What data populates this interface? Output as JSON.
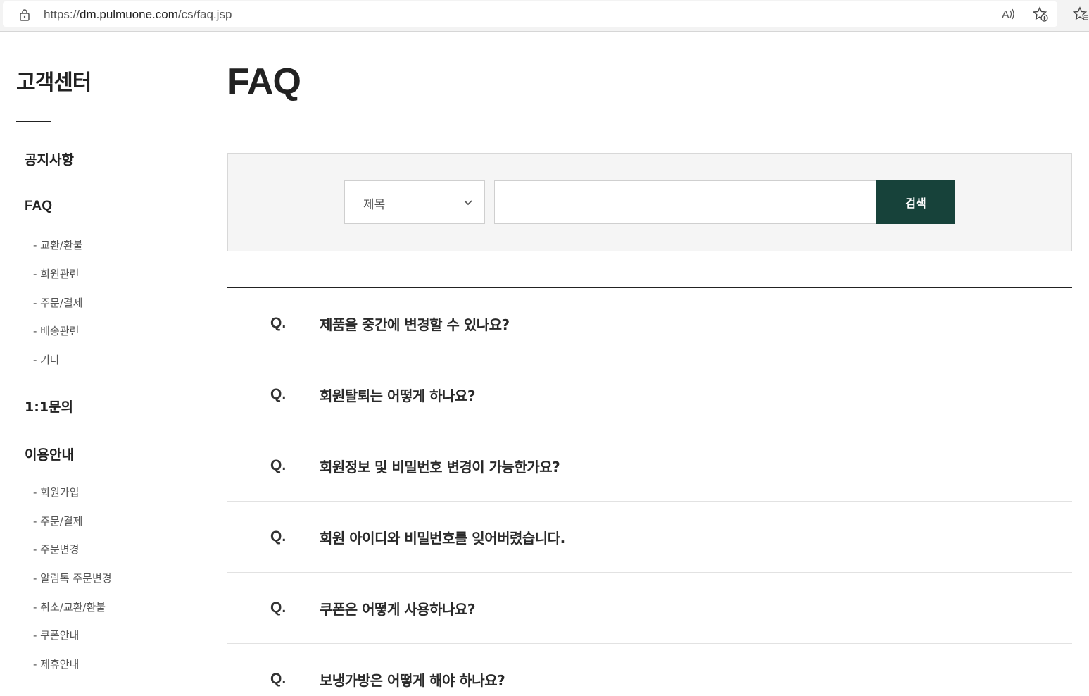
{
  "browser": {
    "url_scheme": "https://",
    "url_host": "dm.pulmuone.com",
    "url_path": "/cs/faq.jsp",
    "read_aloud_label": "A))"
  },
  "sidebar": {
    "title": "고객센터",
    "notice": "공지사항",
    "faq": "FAQ",
    "faq_sub": [
      "- 교환/환불",
      "- 회원관련",
      "- 주문/결제",
      "- 배송관련",
      "- 기타"
    ],
    "inquiry": "1:1문의",
    "guide": "이용안내",
    "guide_sub": [
      "- 회원가입",
      "- 주문/결제",
      "- 주문변경",
      "- 알림톡 주문변경",
      "- 취소/교환/환불",
      "- 쿠폰안내",
      "- 제휴안내"
    ]
  },
  "main": {
    "title": "FAQ",
    "search": {
      "select_value": "제목",
      "input_value": "",
      "button_label": "검색",
      "button_color": "#17423a"
    },
    "faq_prefix": "Q.",
    "faqs": [
      "제품을 중간에 변경할 수 있나요?",
      "회원탈퇴는 어떻게 하나요?",
      "회원정보 및 비밀번호 변경이 가능한가요?",
      "회원 아이디와 비밀번호를 잊어버렸습니다.",
      "쿠폰은 어떻게 사용하나요?",
      "보냉가방은 어떻게 해야 하나요?"
    ]
  }
}
